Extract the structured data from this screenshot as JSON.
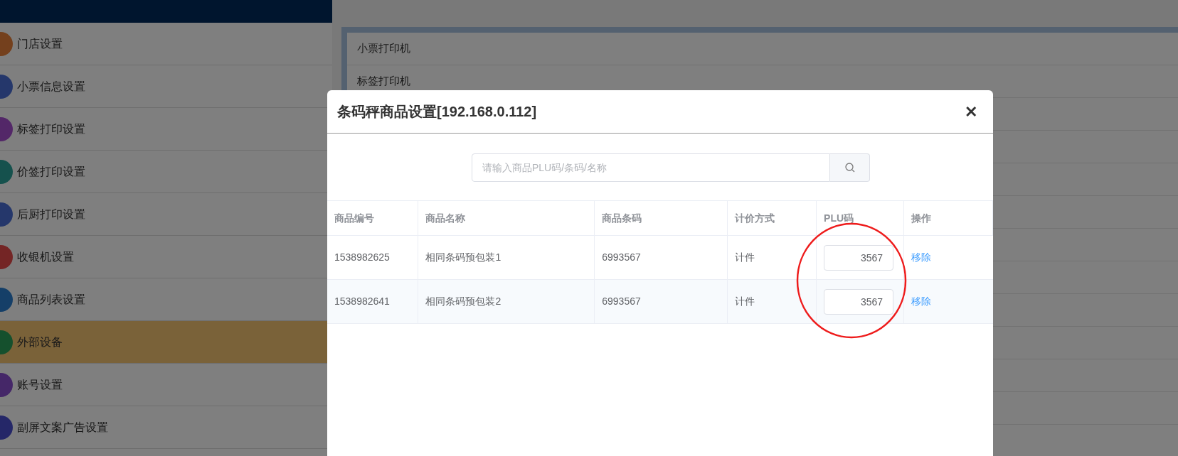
{
  "sidebar": {
    "items": [
      {
        "label": "门店设置",
        "selected": false
      },
      {
        "label": "小票信息设置",
        "selected": false
      },
      {
        "label": "标签打印设置",
        "selected": false
      },
      {
        "label": "价签打印设置",
        "selected": false
      },
      {
        "label": "后厨打印设置",
        "selected": false
      },
      {
        "label": "收银机设置",
        "selected": false
      },
      {
        "label": "商品列表设置",
        "selected": false
      },
      {
        "label": "外部设备",
        "selected": true
      },
      {
        "label": "账号设置",
        "selected": false
      },
      {
        "label": "副屏文案广告设置",
        "selected": false
      }
    ]
  },
  "device_list": {
    "items": [
      "小票打印机",
      "标签打印机"
    ]
  },
  "dialog": {
    "title": "条码秤商品设置[192.168.0.112]",
    "close": "✕",
    "search": {
      "placeholder": "请输入商品PLU码/条码/名称"
    },
    "table": {
      "columns": [
        "商品编号",
        "商品名称",
        "商品条码",
        "计价方式",
        "PLU码",
        "操作"
      ],
      "rows": [
        {
          "id": "1538982625",
          "name": "相同条码预包装1",
          "barcode": "6993567",
          "pricing": "计件",
          "plu": "3567",
          "action": "移除"
        },
        {
          "id": "1538982641",
          "name": "相同条码预包装2",
          "barcode": "6993567",
          "pricing": "计件",
          "plu": "3567",
          "action": "移除"
        }
      ]
    }
  }
}
